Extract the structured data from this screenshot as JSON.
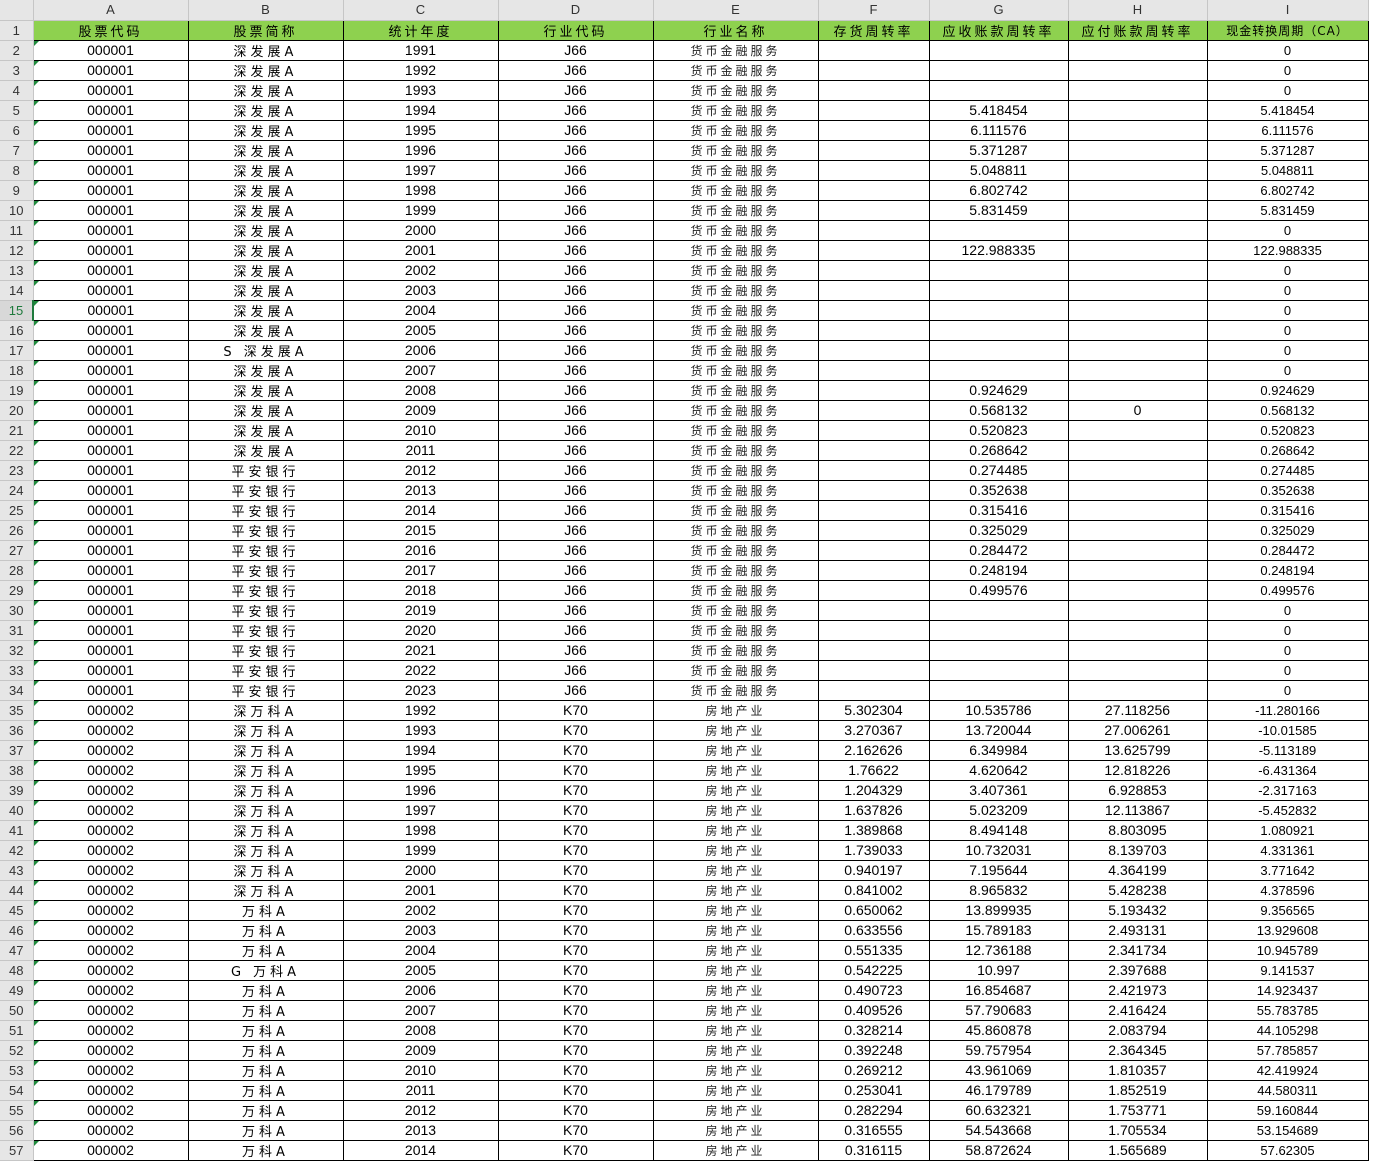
{
  "columns": [
    "A",
    "B",
    "C",
    "D",
    "E",
    "F",
    "G",
    "H",
    "I"
  ],
  "active_row": "15",
  "header": [
    "股票代码",
    "股票简称",
    "统计年度",
    "行业代码",
    "行业名称",
    "存货周转率",
    "应收账款周转率",
    "应付账款周转率",
    "现金转换周期（CA）"
  ],
  "rows": [
    [
      "2",
      "000001",
      "深发展A",
      "1991",
      "J66",
      "货币金融服务",
      "",
      "",
      "",
      "0"
    ],
    [
      "3",
      "000001",
      "深发展A",
      "1992",
      "J66",
      "货币金融服务",
      "",
      "",
      "",
      "0"
    ],
    [
      "4",
      "000001",
      "深发展A",
      "1993",
      "J66",
      "货币金融服务",
      "",
      "",
      "",
      "0"
    ],
    [
      "5",
      "000001",
      "深发展A",
      "1994",
      "J66",
      "货币金融服务",
      "",
      "5.418454",
      "",
      "5.418454"
    ],
    [
      "6",
      "000001",
      "深发展A",
      "1995",
      "J66",
      "货币金融服务",
      "",
      "6.111576",
      "",
      "6.111576"
    ],
    [
      "7",
      "000001",
      "深发展A",
      "1996",
      "J66",
      "货币金融服务",
      "",
      "5.371287",
      "",
      "5.371287"
    ],
    [
      "8",
      "000001",
      "深发展A",
      "1997",
      "J66",
      "货币金融服务",
      "",
      "5.048811",
      "",
      "5.048811"
    ],
    [
      "9",
      "000001",
      "深发展A",
      "1998",
      "J66",
      "货币金融服务",
      "",
      "6.802742",
      "",
      "6.802742"
    ],
    [
      "10",
      "000001",
      "深发展A",
      "1999",
      "J66",
      "货币金融服务",
      "",
      "5.831459",
      "",
      "5.831459"
    ],
    [
      "11",
      "000001",
      "深发展A",
      "2000",
      "J66",
      "货币金融服务",
      "",
      "",
      "",
      "0"
    ],
    [
      "12",
      "000001",
      "深发展A",
      "2001",
      "J66",
      "货币金融服务",
      "",
      "122.988335",
      "",
      "122.988335"
    ],
    [
      "13",
      "000001",
      "深发展A",
      "2002",
      "J66",
      "货币金融服务",
      "",
      "",
      "",
      "0"
    ],
    [
      "14",
      "000001",
      "深发展A",
      "2003",
      "J66",
      "货币金融服务",
      "",
      "",
      "",
      "0"
    ],
    [
      "15",
      "000001",
      "深发展A",
      "2004",
      "J66",
      "货币金融服务",
      "",
      "",
      "",
      "0"
    ],
    [
      "16",
      "000001",
      "深发展A",
      "2005",
      "J66",
      "货币金融服务",
      "",
      "",
      "",
      "0"
    ],
    [
      "17",
      "000001",
      "S 深发展A",
      "2006",
      "J66",
      "货币金融服务",
      "",
      "",
      "",
      "0"
    ],
    [
      "18",
      "000001",
      "深发展A",
      "2007",
      "J66",
      "货币金融服务",
      "",
      "",
      "",
      "0"
    ],
    [
      "19",
      "000001",
      "深发展A",
      "2008",
      "J66",
      "货币金融服务",
      "",
      "0.924629",
      "",
      "0.924629"
    ],
    [
      "20",
      "000001",
      "深发展A",
      "2009",
      "J66",
      "货币金融服务",
      "",
      "0.568132",
      "0",
      "0.568132"
    ],
    [
      "21",
      "000001",
      "深发展A",
      "2010",
      "J66",
      "货币金融服务",
      "",
      "0.520823",
      "",
      "0.520823"
    ],
    [
      "22",
      "000001",
      "深发展A",
      "2011",
      "J66",
      "货币金融服务",
      "",
      "0.268642",
      "",
      "0.268642"
    ],
    [
      "23",
      "000001",
      "平安银行",
      "2012",
      "J66",
      "货币金融服务",
      "",
      "0.274485",
      "",
      "0.274485"
    ],
    [
      "24",
      "000001",
      "平安银行",
      "2013",
      "J66",
      "货币金融服务",
      "",
      "0.352638",
      "",
      "0.352638"
    ],
    [
      "25",
      "000001",
      "平安银行",
      "2014",
      "J66",
      "货币金融服务",
      "",
      "0.315416",
      "",
      "0.315416"
    ],
    [
      "26",
      "000001",
      "平安银行",
      "2015",
      "J66",
      "货币金融服务",
      "",
      "0.325029",
      "",
      "0.325029"
    ],
    [
      "27",
      "000001",
      "平安银行",
      "2016",
      "J66",
      "货币金融服务",
      "",
      "0.284472",
      "",
      "0.284472"
    ],
    [
      "28",
      "000001",
      "平安银行",
      "2017",
      "J66",
      "货币金融服务",
      "",
      "0.248194",
      "",
      "0.248194"
    ],
    [
      "29",
      "000001",
      "平安银行",
      "2018",
      "J66",
      "货币金融服务",
      "",
      "0.499576",
      "",
      "0.499576"
    ],
    [
      "30",
      "000001",
      "平安银行",
      "2019",
      "J66",
      "货币金融服务",
      "",
      "",
      "",
      "0"
    ],
    [
      "31",
      "000001",
      "平安银行",
      "2020",
      "J66",
      "货币金融服务",
      "",
      "",
      "",
      "0"
    ],
    [
      "32",
      "000001",
      "平安银行",
      "2021",
      "J66",
      "货币金融服务",
      "",
      "",
      "",
      "0"
    ],
    [
      "33",
      "000001",
      "平安银行",
      "2022",
      "J66",
      "货币金融服务",
      "",
      "",
      "",
      "0"
    ],
    [
      "34",
      "000001",
      "平安银行",
      "2023",
      "J66",
      "货币金融服务",
      "",
      "",
      "",
      "0"
    ],
    [
      "35",
      "000002",
      "深万科A",
      "1992",
      "K70",
      "房地产业",
      "5.302304",
      "10.535786",
      "27.118256",
      "-11.280166"
    ],
    [
      "36",
      "000002",
      "深万科A",
      "1993",
      "K70",
      "房地产业",
      "3.270367",
      "13.720044",
      "27.006261",
      "-10.01585"
    ],
    [
      "37",
      "000002",
      "深万科A",
      "1994",
      "K70",
      "房地产业",
      "2.162626",
      "6.349984",
      "13.625799",
      "-5.113189"
    ],
    [
      "38",
      "000002",
      "深万科A",
      "1995",
      "K70",
      "房地产业",
      "1.76622",
      "4.620642",
      "12.818226",
      "-6.431364"
    ],
    [
      "39",
      "000002",
      "深万科A",
      "1996",
      "K70",
      "房地产业",
      "1.204329",
      "3.407361",
      "6.928853",
      "-2.317163"
    ],
    [
      "40",
      "000002",
      "深万科A",
      "1997",
      "K70",
      "房地产业",
      "1.637826",
      "5.023209",
      "12.113867",
      "-5.452832"
    ],
    [
      "41",
      "000002",
      "深万科A",
      "1998",
      "K70",
      "房地产业",
      "1.389868",
      "8.494148",
      "8.803095",
      "1.080921"
    ],
    [
      "42",
      "000002",
      "深万科A",
      "1999",
      "K70",
      "房地产业",
      "1.739033",
      "10.732031",
      "8.139703",
      "4.331361"
    ],
    [
      "43",
      "000002",
      "深万科A",
      "2000",
      "K70",
      "房地产业",
      "0.940197",
      "7.195644",
      "4.364199",
      "3.771642"
    ],
    [
      "44",
      "000002",
      "深万科A",
      "2001",
      "K70",
      "房地产业",
      "0.841002",
      "8.965832",
      "5.428238",
      "4.378596"
    ],
    [
      "45",
      "000002",
      "万科A",
      "2002",
      "K70",
      "房地产业",
      "0.650062",
      "13.899935",
      "5.193432",
      "9.356565"
    ],
    [
      "46",
      "000002",
      "万科A",
      "2003",
      "K70",
      "房地产业",
      "0.633556",
      "15.789183",
      "2.493131",
      "13.929608"
    ],
    [
      "47",
      "000002",
      "万科A",
      "2004",
      "K70",
      "房地产业",
      "0.551335",
      "12.736188",
      "2.341734",
      "10.945789"
    ],
    [
      "48",
      "000002",
      "G 万科A",
      "2005",
      "K70",
      "房地产业",
      "0.542225",
      "10.997",
      "2.397688",
      "9.141537"
    ],
    [
      "49",
      "000002",
      "万科A",
      "2006",
      "K70",
      "房地产业",
      "0.490723",
      "16.854687",
      "2.421973",
      "14.923437"
    ],
    [
      "50",
      "000002",
      "万科A",
      "2007",
      "K70",
      "房地产业",
      "0.409526",
      "57.790683",
      "2.416424",
      "55.783785"
    ],
    [
      "51",
      "000002",
      "万科A",
      "2008",
      "K70",
      "房地产业",
      "0.328214",
      "45.860878",
      "2.083794",
      "44.105298"
    ],
    [
      "52",
      "000002",
      "万科A",
      "2009",
      "K70",
      "房地产业",
      "0.392248",
      "59.757954",
      "2.364345",
      "57.785857"
    ],
    [
      "53",
      "000002",
      "万科A",
      "2010",
      "K70",
      "房地产业",
      "0.269212",
      "43.961069",
      "1.810357",
      "42.419924"
    ],
    [
      "54",
      "000002",
      "万科A",
      "2011",
      "K70",
      "房地产业",
      "0.253041",
      "46.179789",
      "1.852519",
      "44.580311"
    ],
    [
      "55",
      "000002",
      "万科A",
      "2012",
      "K70",
      "房地产业",
      "0.282294",
      "60.632321",
      "1.753771",
      "59.160844"
    ],
    [
      "56",
      "000002",
      "万科A",
      "2013",
      "K70",
      "房地产业",
      "0.316555",
      "54.543668",
      "1.705534",
      "53.154689"
    ],
    [
      "57",
      "000002",
      "万科A",
      "2014",
      "K70",
      "房地产业",
      "0.316115",
      "58.872624",
      "1.565689",
      "57.62305"
    ]
  ]
}
